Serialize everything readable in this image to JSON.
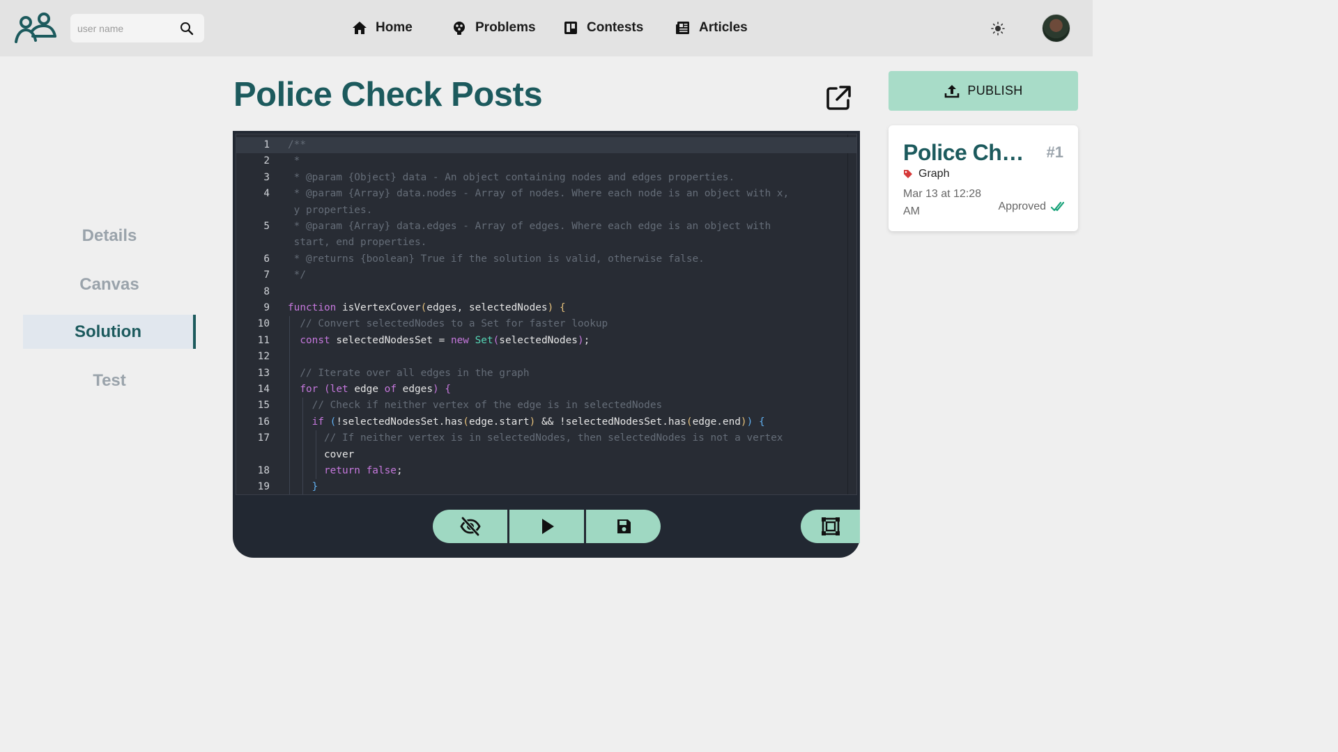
{
  "header": {
    "search_placeholder": "user name",
    "nav": [
      {
        "label": "Home",
        "icon": "home-icon"
      },
      {
        "label": "Problems",
        "icon": "problems-icon"
      },
      {
        "label": "Contests",
        "icon": "contests-icon"
      },
      {
        "label": "Articles",
        "icon": "articles-icon"
      }
    ]
  },
  "sidebar": {
    "items": [
      {
        "label": "Details"
      },
      {
        "label": "Canvas"
      },
      {
        "label": "Solution",
        "active": true
      },
      {
        "label": "Test"
      }
    ]
  },
  "page": {
    "title": "Police Check Posts"
  },
  "editor": {
    "lines": [
      {
        "n": "1",
        "text": "/**"
      },
      {
        "n": "2",
        "text": " *"
      },
      {
        "n": "3",
        "text": " * @param {Object} data - An object containing nodes and edges properties."
      },
      {
        "n": "4",
        "text": " * @param {Array} data.nodes - Array of nodes. Where each node is an object with x,"
      },
      {
        "n": "",
        "text": " y properties."
      },
      {
        "n": "5",
        "text": " * @param {Array} data.edges - Array of edges. Where each edge is an object with"
      },
      {
        "n": "",
        "text": " start, end properties."
      },
      {
        "n": "6",
        "text": " * @returns {boolean} True if the solution is valid, otherwise false."
      },
      {
        "n": "7",
        "text": " */"
      },
      {
        "n": "8",
        "text": ""
      },
      {
        "n": "9",
        "text": "function isVertexCover(edges, selectedNodes) {"
      },
      {
        "n": "10",
        "text": "  // Convert selectedNodes to a Set for faster lookup"
      },
      {
        "n": "11",
        "text": "  const selectedNodesSet = new Set(selectedNodes);"
      },
      {
        "n": "12",
        "text": ""
      },
      {
        "n": "13",
        "text": "  // Iterate over all edges in the graph"
      },
      {
        "n": "14",
        "text": "  for (let edge of edges) {"
      },
      {
        "n": "15",
        "text": "    // Check if neither vertex of the edge is in selectedNodes"
      },
      {
        "n": "16",
        "text": "    if (!selectedNodesSet.has(edge.start) && !selectedNodesSet.has(edge.end)) {"
      },
      {
        "n": "17",
        "text": "      // If neither vertex is in selectedNodes, then selectedNodes is not a vertex"
      },
      {
        "n": "",
        "text": "      cover"
      },
      {
        "n": "18",
        "text": "      return false;"
      },
      {
        "n": "19",
        "text": "    }"
      }
    ]
  },
  "toolbar": {
    "buttons": [
      {
        "name": "toggle-visibility-button",
        "icon": "eye-slash-icon"
      },
      {
        "name": "run-button",
        "icon": "play-icon"
      },
      {
        "name": "save-button",
        "icon": "save-icon"
      }
    ],
    "fullscreen_icon": "fullscreen-icon"
  },
  "publish": {
    "label": "PUBLISH"
  },
  "card": {
    "title": "Police Check Posts",
    "number": "#1",
    "tag": "Graph",
    "date": "Mar 13 at 12:28 AM",
    "status": "Approved"
  },
  "colors": {
    "accent": "#1c5a5d",
    "mint": "#9fd8c2",
    "editor_bg": "#282c34"
  }
}
